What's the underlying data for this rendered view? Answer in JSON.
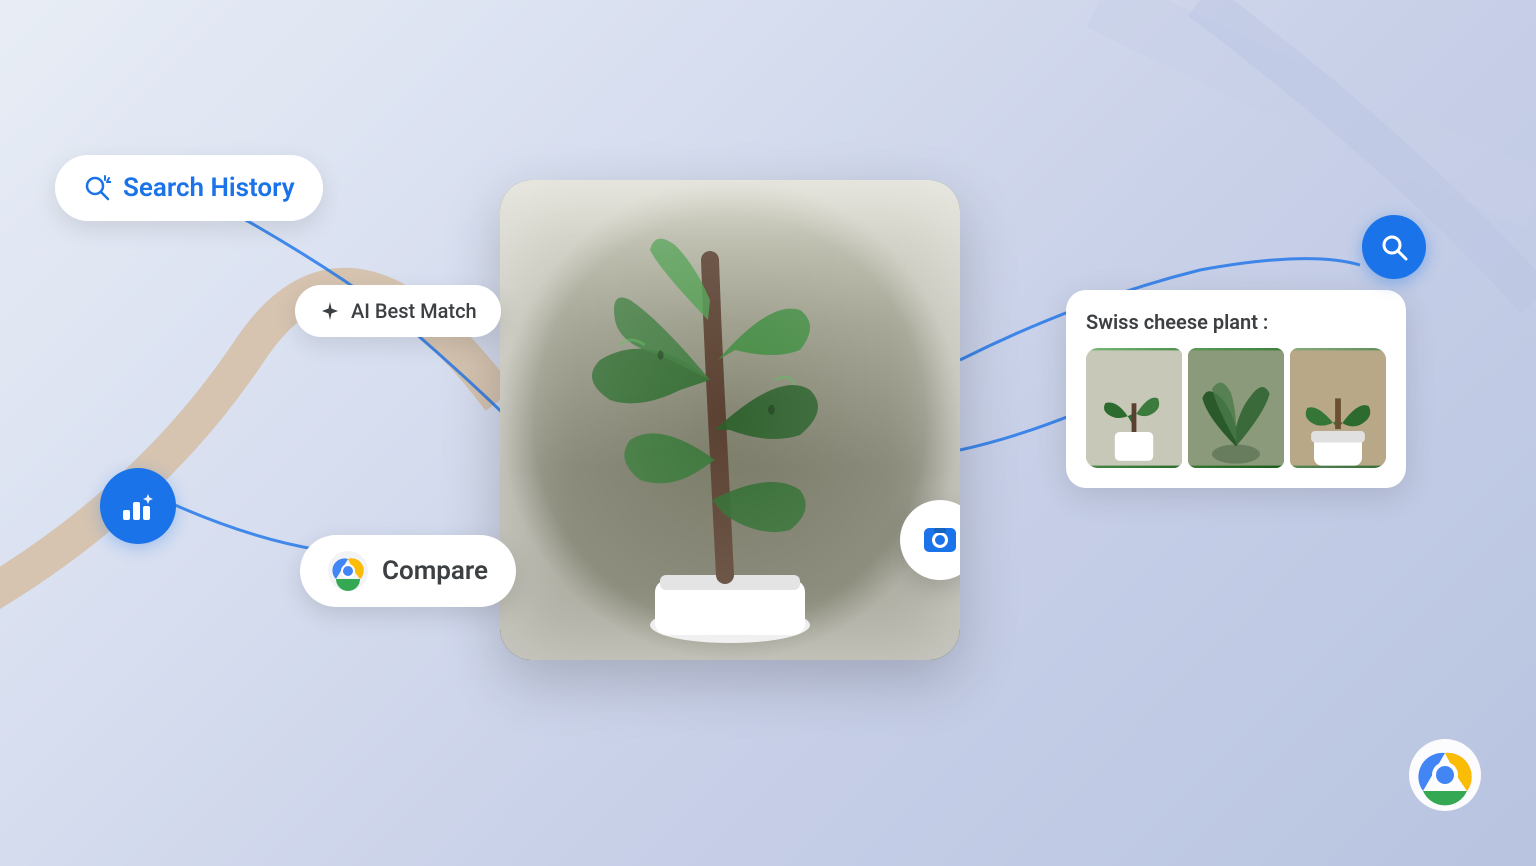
{
  "background": {
    "gradient_start": "#e8edf5",
    "gradient_end": "#b8c4e0"
  },
  "search_history": {
    "label": "Search History",
    "icon": "search-history-icon"
  },
  "ai_best_match": {
    "label": "AI Best Match",
    "icon": "star-icon"
  },
  "compare": {
    "label": "Compare",
    "icon": "chrome-logo"
  },
  "result_card": {
    "title": "Swiss cheese plant :",
    "images": [
      "plant-img-1",
      "plant-img-2",
      "plant-img-3"
    ]
  },
  "decorative": {
    "accent_color": "#1a73e8",
    "curve_color_1": "#1a73e8",
    "curve_color_2": "#d4b896"
  }
}
